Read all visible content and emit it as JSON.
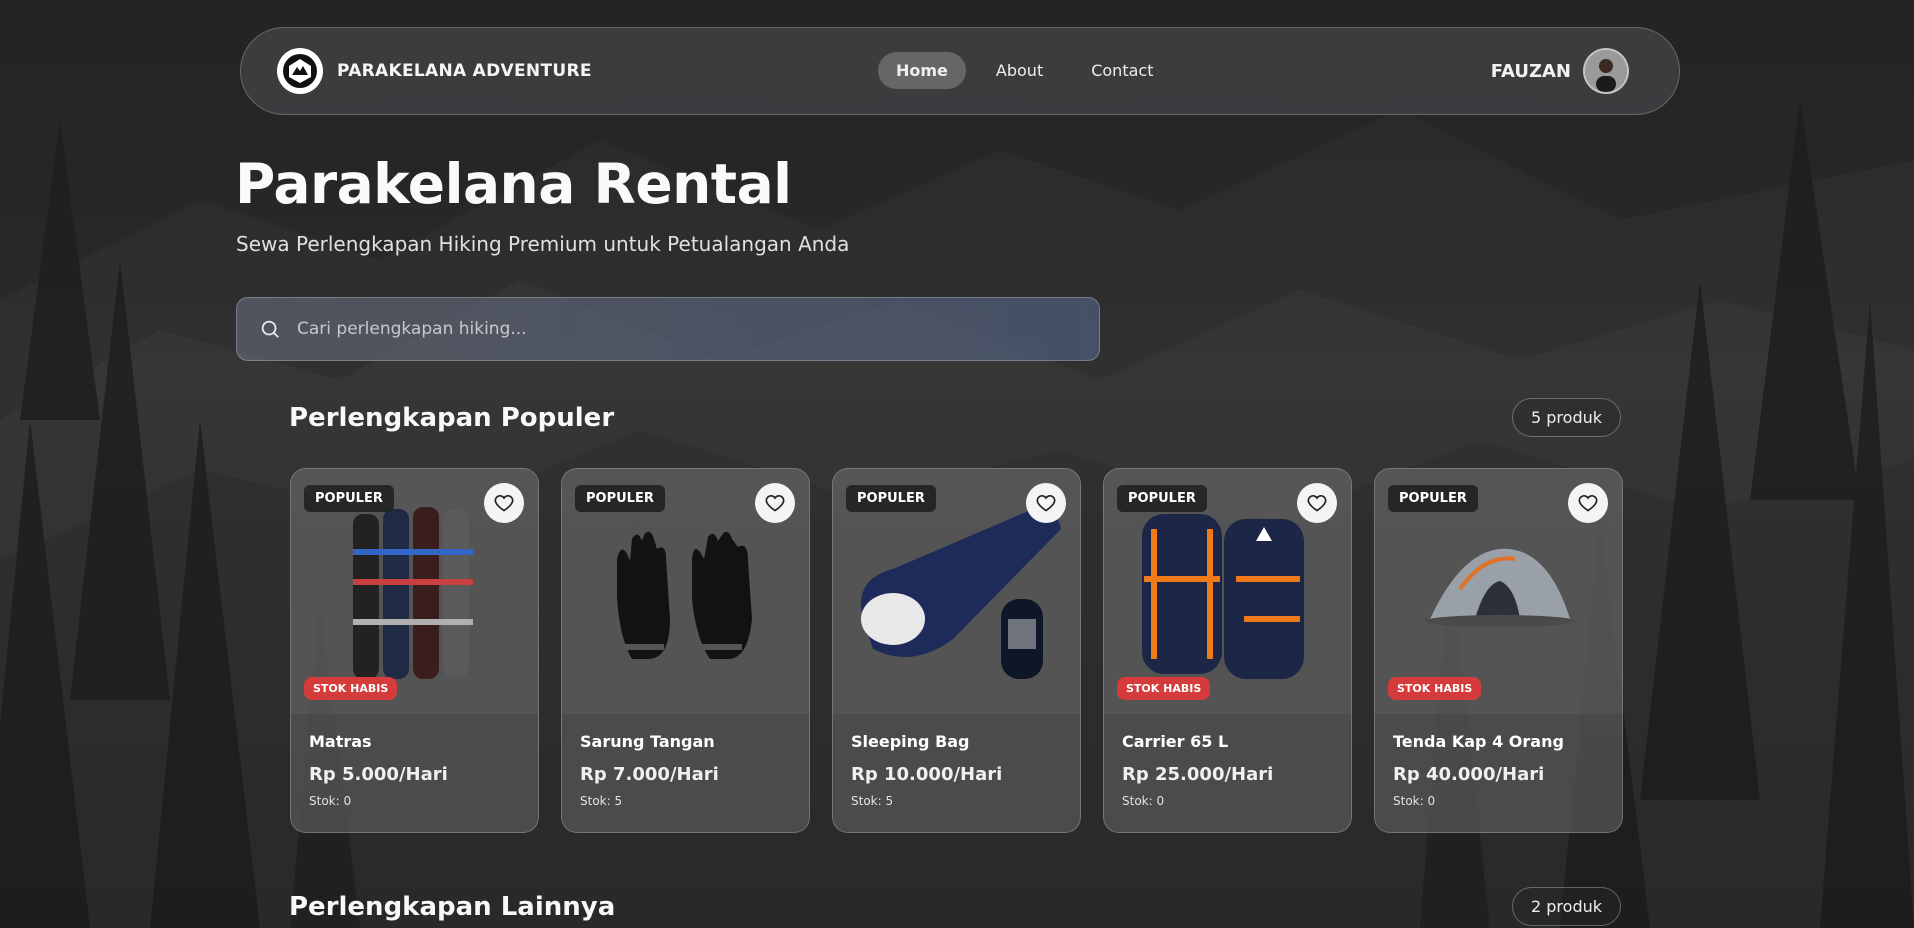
{
  "navbar": {
    "brand": "PARAKELANA ADVENTURE",
    "links": [
      {
        "label": "Home",
        "active": true
      },
      {
        "label": "About",
        "active": false
      },
      {
        "label": "Contact",
        "active": false
      }
    ],
    "user_name": "FAUZAN",
    "avatar_icon": "user-avatar-photo"
  },
  "hero": {
    "title": "Parakelana Rental",
    "subtitle": "Sewa Perlengkapan Hiking Premium untuk Petualangan Anda"
  },
  "search": {
    "placeholder": "Cari perlengkapan hiking...",
    "value": "",
    "icon": "search-icon"
  },
  "sections": [
    {
      "title": "Perlengkapan Populer",
      "count": "5 produk"
    },
    {
      "title": "Perlengkapan Lainnya",
      "count": "2 produk"
    }
  ],
  "products": [
    {
      "badge": "POPULER",
      "out_label": "STOK HABIS",
      "out_of_stock": true,
      "name": "Matras",
      "price": "Rp 5.000/Hari",
      "stock": "Stok: 0",
      "image_icon": "sleeping-mat-rolls"
    },
    {
      "badge": "POPULER",
      "out_label": "",
      "out_of_stock": false,
      "name": "Sarung Tangan",
      "price": "Rp 7.000/Hari",
      "stock": "Stok: 5",
      "image_icon": "gloves"
    },
    {
      "badge": "POPULER",
      "out_label": "",
      "out_of_stock": false,
      "name": "Sleeping Bag",
      "price": "Rp 10.000/Hari",
      "stock": "Stok: 5",
      "image_icon": "sleeping-bag"
    },
    {
      "badge": "POPULER",
      "out_label": "STOK HABIS",
      "out_of_stock": true,
      "name": "Carrier 65 L",
      "price": "Rp 25.000/Hari",
      "stock": "Stok: 0",
      "image_icon": "backpack"
    },
    {
      "badge": "POPULER",
      "out_label": "STOK HABIS",
      "out_of_stock": true,
      "name": "Tenda Kap 4 Orang",
      "price": "Rp 40.000/Hari",
      "stock": "Stok: 0",
      "image_icon": "tent"
    }
  ],
  "colors": {
    "out_of_stock_badge": "#d63b3b",
    "popular_badge": "#1e1e1e",
    "nav_active_bg": "#6b6b6b"
  }
}
